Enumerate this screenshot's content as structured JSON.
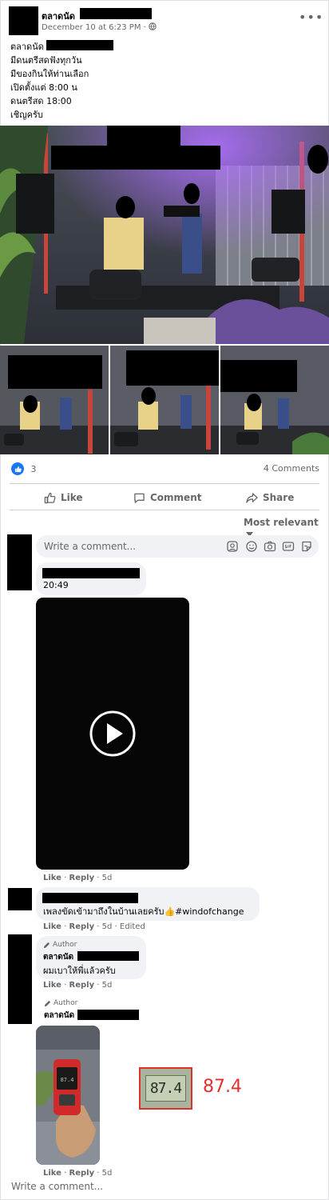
{
  "post": {
    "author": "ตลาดนัด",
    "date": "December 10 at 6:23 PM · ",
    "privacy_icon": "globe-icon",
    "more_label": "•••",
    "text_lines": [
      "ตลาดนัด",
      "มีดนตรีสดฟังทุกวัน",
      "มีของกินให้ท่านเลือก",
      "เปิดตั้งแต่ 8:00 น",
      "ดนตรีสด 18:00",
      "เชิญครับ"
    ]
  },
  "reactions": {
    "count": "3",
    "comments": "4 Comments"
  },
  "actions": {
    "like": "Like",
    "comment": "Comment",
    "share": "Share"
  },
  "comments_section": {
    "sort": "Most relevant",
    "input_placeholder": "Write a comment...",
    "bottom_placeholder": "Write a comment..."
  },
  "comments": [
    {
      "text": "20:49",
      "like": "Like",
      "reply": "Reply",
      "time": "5d"
    },
    {
      "text": "เพลงขัดเข้ามาถึงในบ้านเลยครับ👍#windofchange",
      "like": "Like",
      "reply": "Reply",
      "time": "5d",
      "edited": "Edited"
    },
    {
      "author_tag": "Author",
      "author": "ตลาดนัด",
      "text": "ผมเบาให้พี่แล้วครับ",
      "like": "Like",
      "reply": "Reply",
      "time": "5d"
    },
    {
      "author_tag": "Author",
      "author": "ตลาดนัด",
      "like": "Like",
      "reply": "Reply",
      "time": "5d",
      "meter_display": "87.4",
      "reading": "87.4"
    }
  ],
  "colors": {
    "accent": "#1877f2",
    "meta": "#65676b",
    "bubble": "#f0f2f5",
    "reading": "#e0302c"
  }
}
